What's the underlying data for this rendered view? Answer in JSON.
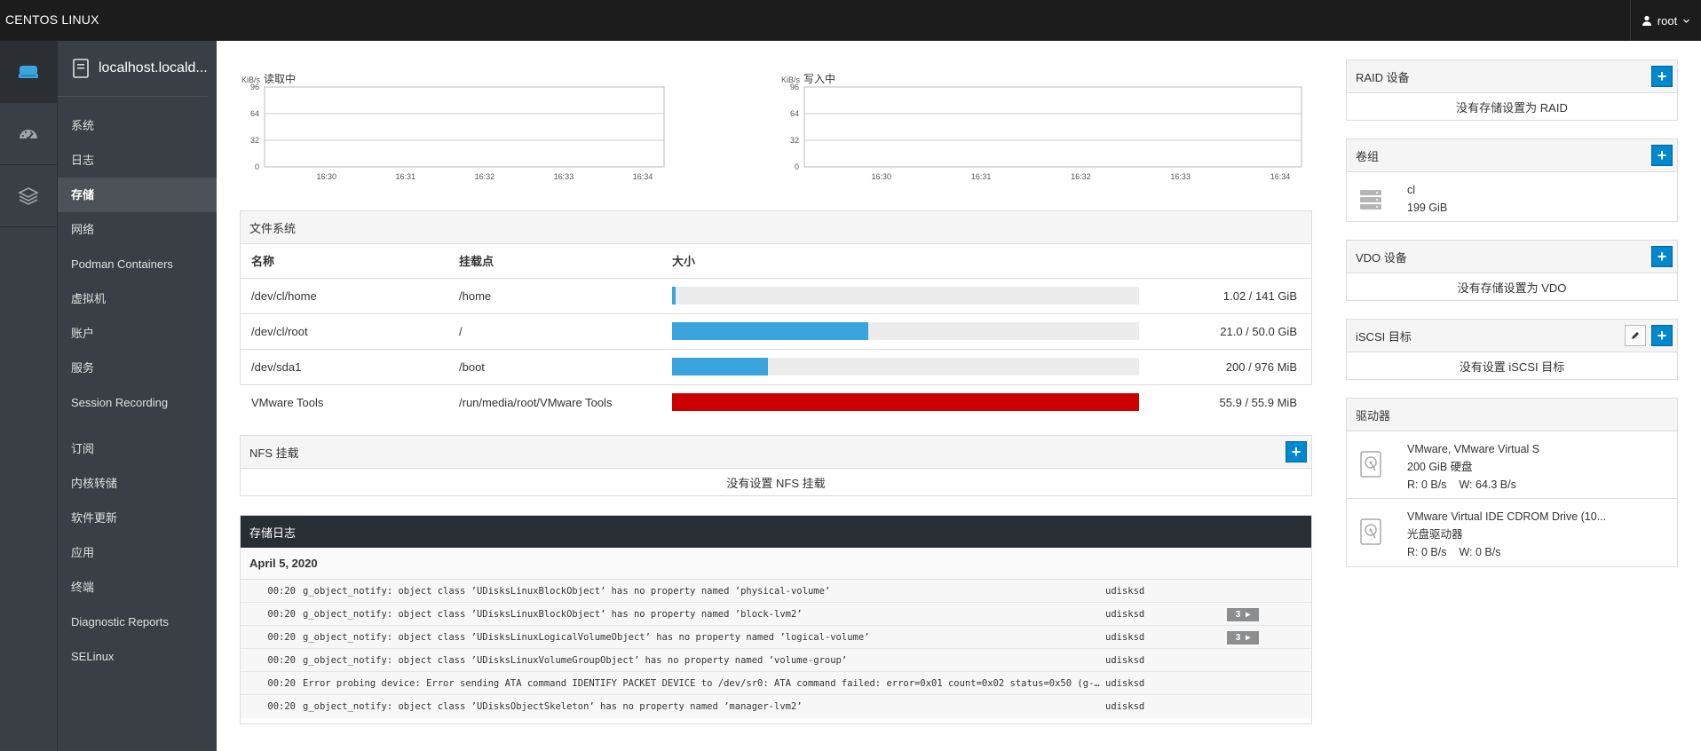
{
  "topbar": {
    "brand": "CENTOS LINUX",
    "user": "root"
  },
  "nav": {
    "host": "localhost.locald...",
    "items": [
      {
        "label": "系统"
      },
      {
        "label": "日志"
      },
      {
        "label": "存储",
        "active": true
      },
      {
        "label": "网络"
      },
      {
        "label": "Podman Containers"
      },
      {
        "label": "虚拟机"
      },
      {
        "label": "账户"
      },
      {
        "label": "服务"
      },
      {
        "label": "Session Recording"
      },
      {
        "label": "订阅"
      },
      {
        "label": "内核转储"
      },
      {
        "label": "软件更新"
      },
      {
        "label": "应用"
      },
      {
        "label": "终端"
      },
      {
        "label": "Diagnostic Reports"
      },
      {
        "label": "SELinux"
      }
    ]
  },
  "charts": {
    "read": {
      "unit": "KiB/s",
      "title": "读取中"
    },
    "write": {
      "unit": "KiB/s",
      "title": "写入中"
    }
  },
  "chart_data": [
    {
      "type": "line",
      "title": "读取中",
      "ylabel": "KiB/s",
      "ylim": [
        0,
        96
      ],
      "yticks": [
        "96",
        "64",
        "32",
        "0"
      ],
      "xticks": [
        "16:30",
        "16:31",
        "16:32",
        "16:33",
        "16:34"
      ],
      "series": []
    },
    {
      "type": "line",
      "title": "写入中",
      "ylabel": "KiB/s",
      "ylim": [
        0,
        96
      ],
      "yticks": [
        "96",
        "64",
        "32",
        "0"
      ],
      "xticks": [
        "16:30",
        "16:31",
        "16:32",
        "16:33",
        "16:34"
      ],
      "series": []
    }
  ],
  "filesystems": {
    "title": "文件系统",
    "columns": {
      "name": "名称",
      "mount": "挂载点",
      "size": "大小"
    },
    "rows": [
      {
        "name": "/dev/cl/home",
        "mount": "/home",
        "usage": 1.02,
        "total": 141,
        "fill_pct": 0.7,
        "full": false,
        "size": "1.02 / 141 GiB"
      },
      {
        "name": "/dev/cl/root",
        "mount": "/",
        "usage": 21.0,
        "total": 50.0,
        "fill_pct": 42,
        "full": false,
        "size": "21.0 / 50.0 GiB"
      },
      {
        "name": "/dev/sda1",
        "mount": "/boot",
        "usage": 200,
        "total": 976,
        "fill_pct": 20.5,
        "full": false,
        "size": "200 / 976 MiB"
      },
      {
        "name": "VMware Tools",
        "mount": "/run/media/root/VMware Tools",
        "usage": 55.9,
        "total": 55.9,
        "fill_pct": 100,
        "full": true,
        "size": "55.9 / 55.9 MiB"
      }
    ]
  },
  "nfs": {
    "title": "NFS 挂载",
    "empty": "没有设置 NFS 挂载"
  },
  "log": {
    "title": "存储日志",
    "date": "April 5, 2020",
    "entries": [
      {
        "time": "00:20",
        "message": "g_object_notify: object class ’UDisksLinuxBlockObject’ has no property named ’physical-volume’",
        "source": "udisksd",
        "count": ""
      },
      {
        "time": "00:20",
        "message": "g_object_notify: object class ’UDisksLinuxBlockObject’ has no property named ’block-lvm2’",
        "source": "udisksd",
        "count": "3"
      },
      {
        "time": "00:20",
        "message": "g_object_notify: object class ’UDisksLinuxLogicalVolumeObject’ has no property named ’logical-volume’",
        "source": "udisksd",
        "count": "3"
      },
      {
        "time": "00:20",
        "message": "g_object_notify: object class ’UDisksLinuxVolumeGroupObject’ has no property named ’volume-group’",
        "source": "udisksd",
        "count": ""
      },
      {
        "time": "00:20",
        "message": "Error probing device: Error sending ATA command IDENTIFY PACKET DEVICE to /dev/sr0: ATA command failed: error=0x01 count=0x02 status=0x50 (g-io-err…",
        "source": "udisksd",
        "count": ""
      },
      {
        "time": "00:20",
        "message": "g_object_notify: object class ’UDisksObjectSkeleton’ has no property named ’manager-lvm2’",
        "source": "udisksd",
        "count": ""
      }
    ]
  },
  "raid": {
    "title": "RAID 设备",
    "empty": "没有存储设置为 RAID"
  },
  "vg": {
    "title": "卷组",
    "items": [
      {
        "name": "cl",
        "size": "199 GiB"
      }
    ]
  },
  "vdo": {
    "title": "VDO 设备",
    "empty": "没有存储设置为 VDO"
  },
  "iscsi": {
    "title": "iSCSI 目标",
    "empty": "没有设置 iSCSI 目标"
  },
  "drives": {
    "title": "驱动器",
    "items": [
      {
        "name": "VMware, VMware Virtual S",
        "type": "200 GiB 硬盘",
        "read": "R: 0 B/s",
        "write": "W: 64.3 B/s"
      },
      {
        "name": "VMware Virtual IDE CDROM Drive (10...",
        "type": "光盘驱动器",
        "read": "R: 0 B/s",
        "write": "W: 0 B/s"
      }
    ]
  },
  "colors": {
    "accent": "#0088ce",
    "bar": "#39a5dc",
    "bar_full": "#cc0000",
    "sidebar": "#393f44",
    "topbar": "#1c1c1c"
  }
}
